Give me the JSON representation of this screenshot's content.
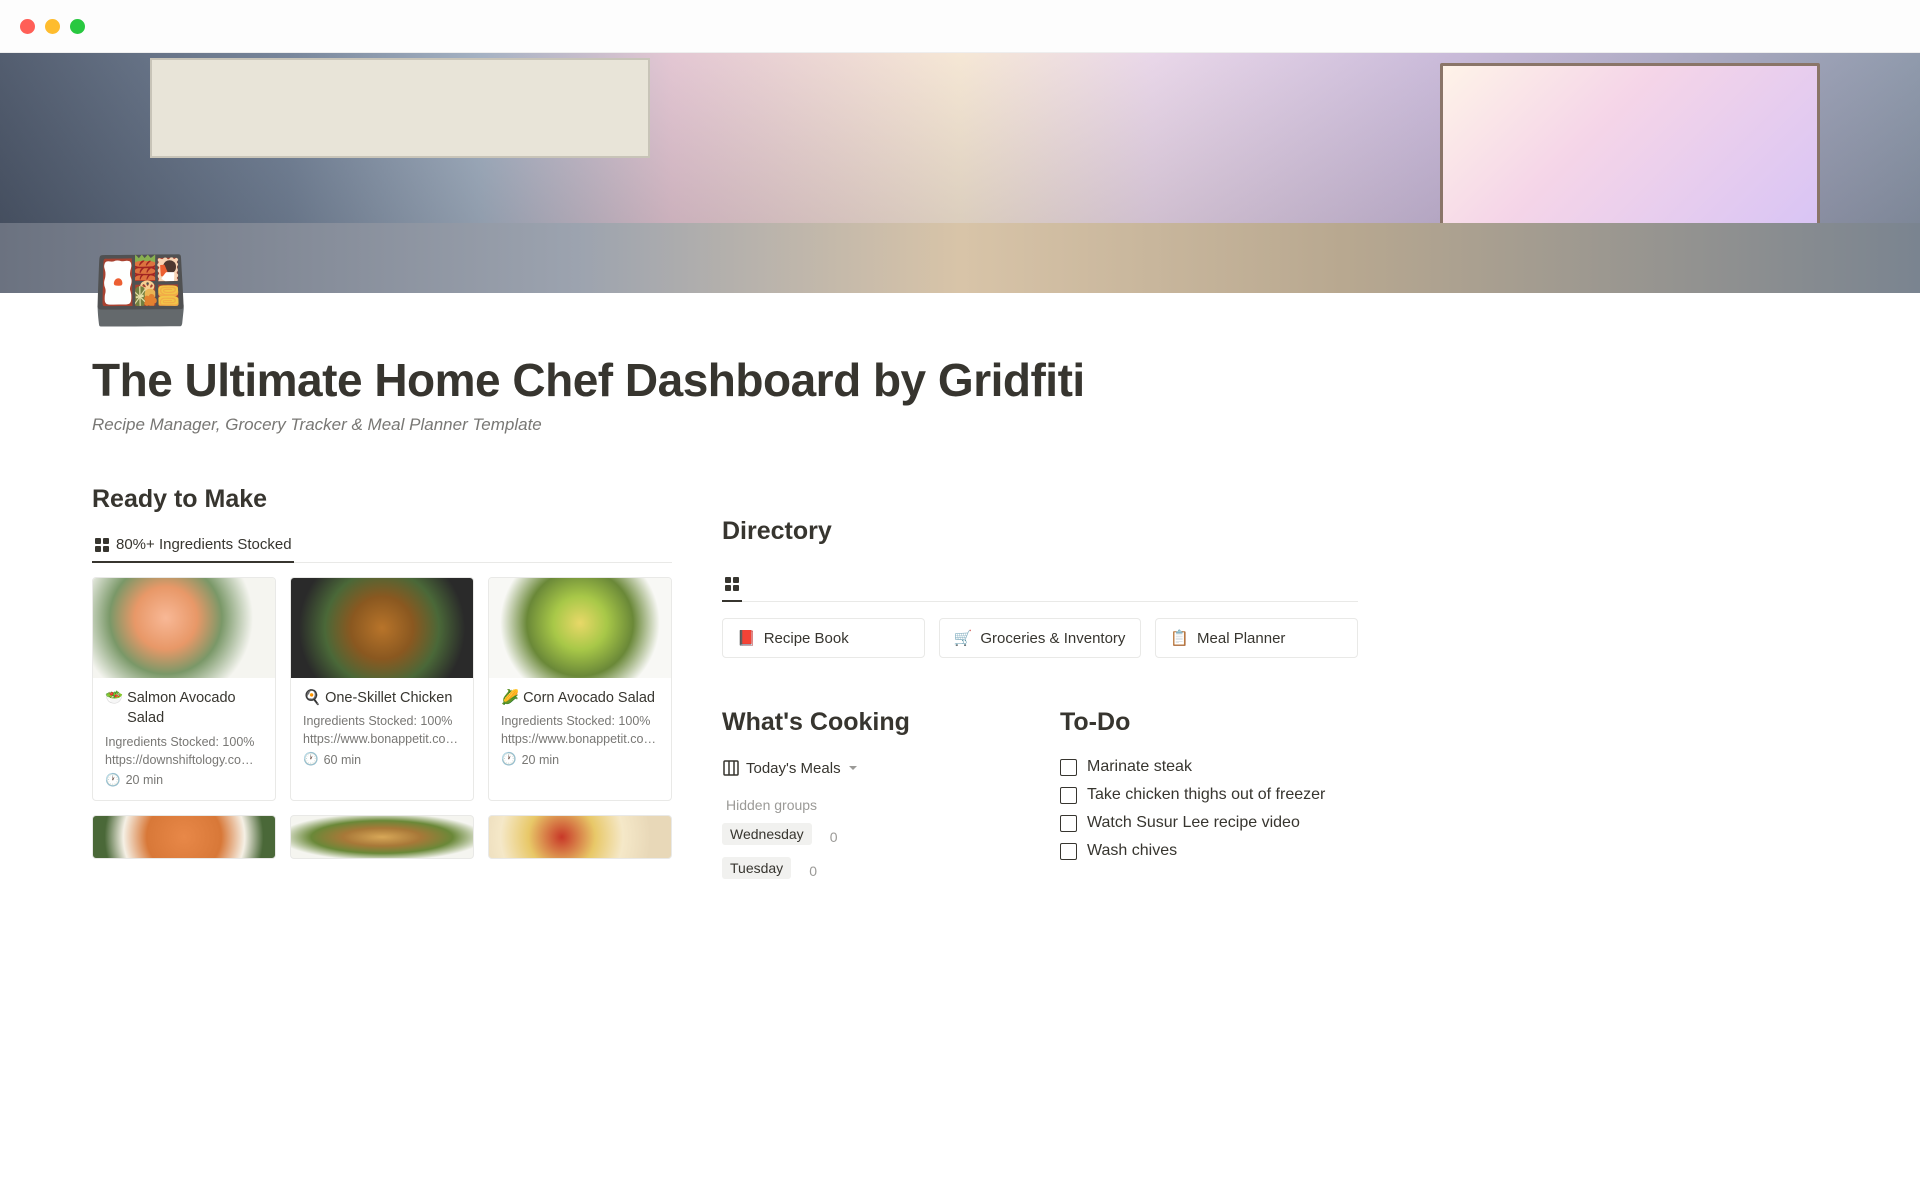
{
  "page": {
    "icon": "🍱",
    "title": "The Ultimate Home Chef Dashboard by Gridfiti",
    "subtitle": "Recipe Manager, Grocery Tracker & Meal Planner Template"
  },
  "ready_to_make": {
    "heading": "Ready to Make",
    "view_tab": "80%+ Ingredients Stocked",
    "cards": [
      {
        "emoji": "🥗",
        "title": "Salmon Avocado Salad",
        "stocked": "Ingredients Stocked: 100%",
        "url": "https://downshiftology.com/reci",
        "time": "20 min"
      },
      {
        "emoji": "🍳",
        "title": "One-Skillet Chicken",
        "stocked": "Ingredients Stocked: 100%",
        "url": "https://www.bonappetit.com/rec",
        "time": "60 min"
      },
      {
        "emoji": "🌽",
        "title": "Corn Avocado Salad",
        "stocked": "Ingredients Stocked: 100%",
        "url": "https://www.bonappetit.com/co",
        "time": "20 min"
      }
    ]
  },
  "directory": {
    "heading": "Directory",
    "cards": [
      {
        "emoji": "📕",
        "label": "Recipe Book"
      },
      {
        "emoji": "🛒",
        "label": "Groceries & Inventory"
      },
      {
        "emoji": "📋",
        "label": "Meal Planner"
      }
    ]
  },
  "whats_cooking": {
    "heading": "What's Cooking",
    "view_label": "Today's Meals",
    "hidden_label": "Hidden groups",
    "days": [
      {
        "name": "Wednesday",
        "count": "0"
      },
      {
        "name": "Tuesday",
        "count": "0"
      }
    ]
  },
  "todo": {
    "heading": "To-Do",
    "items": [
      "Marinate steak",
      "Take chicken thighs out of freezer",
      "Watch Susur Lee recipe video",
      "Wash chives"
    ]
  }
}
